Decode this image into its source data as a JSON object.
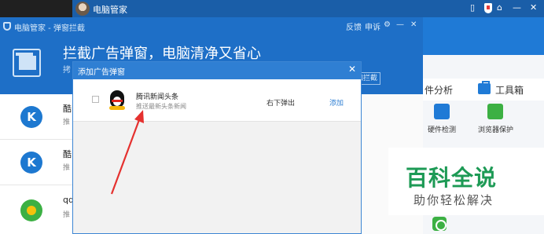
{
  "main_window": {
    "title": "电脑管家",
    "controls": [
      "▯",
      "⌂",
      "—",
      "✕"
    ],
    "tabs": [
      "件分析",
      "工具箱"
    ],
    "tools": [
      "硬件检测",
      "浏览器保护"
    ],
    "colors": {
      "header": "#1e6fc7",
      "accent": "#1f7ad6",
      "green": "#3cb043"
    }
  },
  "popup_window": {
    "title": "电脑管家 - 弹窗拦截",
    "controls": [
      "反馈",
      "申诉",
      "⚙",
      "—",
      "✕"
    ],
    "headline": "拦截广告弹窗，电脑清净又省心",
    "sub_text": "拷",
    "add_button": "添加拦截",
    "background_rows": [
      {
        "icon": "K",
        "name": "酷",
        "sub": "推"
      },
      {
        "icon": "K",
        "name": "酷",
        "sub": "推"
      },
      {
        "icon": "qq-music",
        "name": "qq",
        "sub": "推"
      }
    ]
  },
  "dialog": {
    "title": "添加广告弹窗",
    "close": "✕",
    "rows": [
      {
        "name": "腾讯新闻头条",
        "description": "推送最新头条新闻",
        "position": "右下弹出",
        "action": "添加",
        "icon": "qq-penguin-icon"
      }
    ]
  },
  "watermark": {
    "title": "百科全说",
    "subtitle": "助你轻松解决"
  }
}
